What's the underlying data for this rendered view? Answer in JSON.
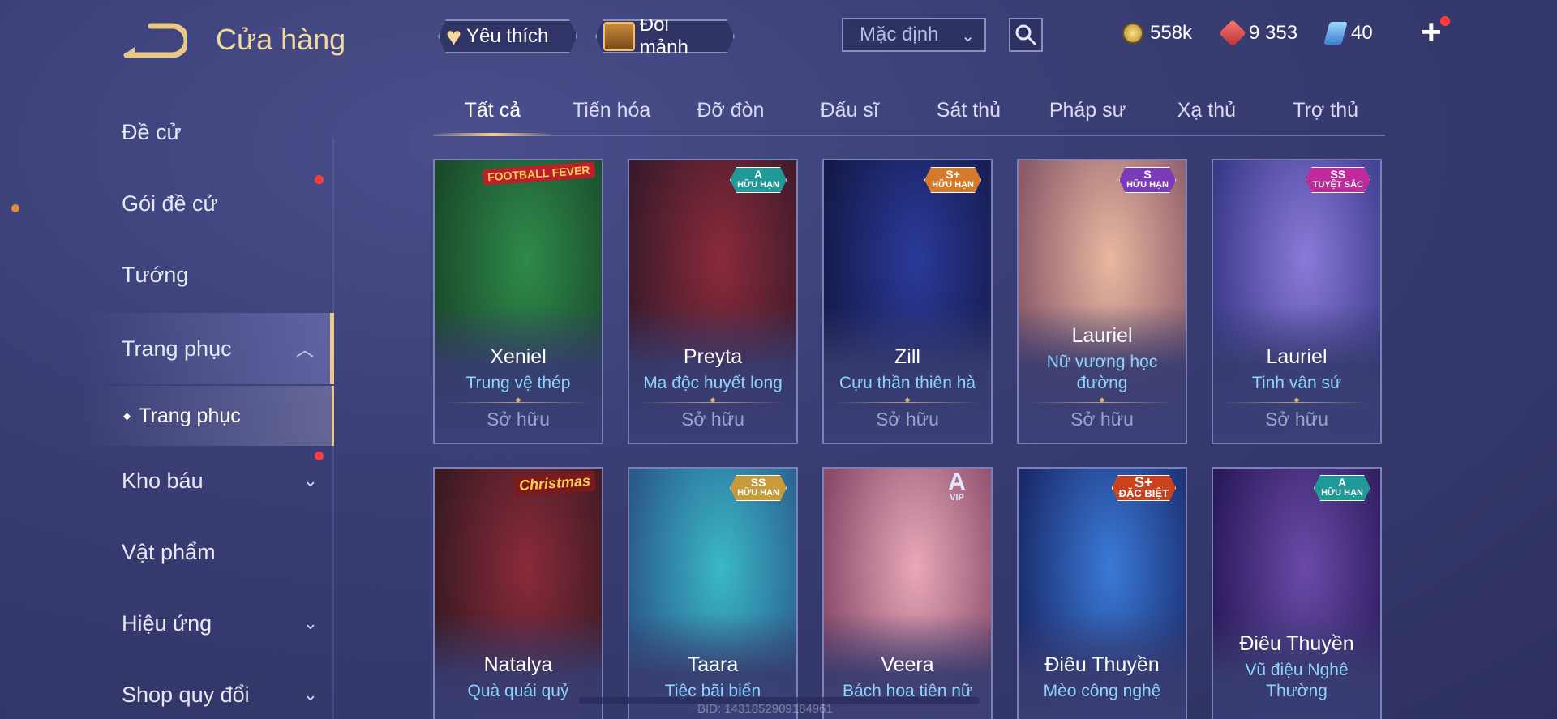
{
  "header": {
    "title": "Cửa hàng",
    "favorites_label": "Yêu thích",
    "exchange_label": "Đổi mảnh",
    "sort_value": "Mặc định",
    "currencies": {
      "gold": "558k",
      "ruby": "9 353",
      "voucher": "40"
    }
  },
  "sidebar": {
    "items": [
      {
        "label": "Đề cử"
      },
      {
        "label": "Gói đề cử"
      },
      {
        "label": "Tướng"
      },
      {
        "label": "Trang phục"
      },
      {
        "label": "Kho báu"
      },
      {
        "label": "Vật phẩm"
      },
      {
        "label": "Hiệu ứng"
      },
      {
        "label": "Shop quy đổi"
      }
    ],
    "sub_item": "Trang phục"
  },
  "tabs": [
    "Tất cả",
    "Tiến hóa",
    "Đỡ đòn",
    "Đấu sĩ",
    "Sát thủ",
    "Pháp sư",
    "Xạ thủ",
    "Trợ thủ"
  ],
  "cards": [
    {
      "hero": "Xeniel",
      "skin": "Trung vệ thép",
      "status": "Sở hữu",
      "tag": "FOOTBALL FEVER",
      "colors": [
        "#2e8a4a",
        "#1a4a2a"
      ]
    },
    {
      "hero": "Preyta",
      "skin": "Ma độc huyết long",
      "status": "Sở hữu",
      "tier": "A",
      "tier_label": "HỮU HẠN",
      "colors": [
        "#8a2a3a",
        "#3a1a2a"
      ]
    },
    {
      "hero": "Zill",
      "skin": "Cựu thần thiên hà",
      "status": "Sở hữu",
      "tier": "S+",
      "tier_label": "HỮU HẠN",
      "colors": [
        "#2a3a9a",
        "#141a4a"
      ]
    },
    {
      "hero": "Lauriel",
      "skin": "Nữ vương học đường",
      "status": "Sở hữu",
      "tier": "S",
      "tier_label": "HỮU HẠN",
      "colors": [
        "#e8b8a0",
        "#8a5a6a"
      ]
    },
    {
      "hero": "Lauriel",
      "skin": "Tinh vân sứ",
      "status": "Sở hữu",
      "tier": "SS",
      "tier_label": "TUYỆT SẮC",
      "colors": [
        "#8a7ad8",
        "#3a3a8a"
      ]
    },
    {
      "hero": "Natalya",
      "skin": "Quà quái quỷ",
      "tag": "Christmas",
      "colors": [
        "#8a2a3a",
        "#3a1a22"
      ]
    },
    {
      "hero": "Taara",
      "skin": "Tiệc bãi biển",
      "tier": "SS",
      "tier_label": "HỮU HẠN",
      "colors": [
        "#3ab8c8",
        "#2a5a8a"
      ]
    },
    {
      "hero": "Veera",
      "skin": "Bách hoa tiên nữ",
      "tier": "A",
      "tier_label": "VIP",
      "colors": [
        "#e8a8b8",
        "#8a4a6a"
      ]
    },
    {
      "hero": "Điêu Thuyền",
      "skin": "Mèo công nghệ",
      "tier": "S+",
      "tier_label": "ĐẶC BIỆT",
      "colors": [
        "#3a7ad8",
        "#1a2a6a"
      ]
    },
    {
      "hero": "Điêu Thuyền",
      "skin": "Vũ điệu Nghê Thường",
      "tier": "A",
      "tier_label": "HỮU HẠN",
      "colors": [
        "#6a4aa8",
        "#2a1a5a"
      ]
    }
  ],
  "footer": {
    "build_id": "BID: 1431852909184961"
  },
  "theme": {
    "accent_gold": "#e8c987",
    "skin_name_blue": "#8fd4ff",
    "notification_red": "#ff3b3b"
  }
}
